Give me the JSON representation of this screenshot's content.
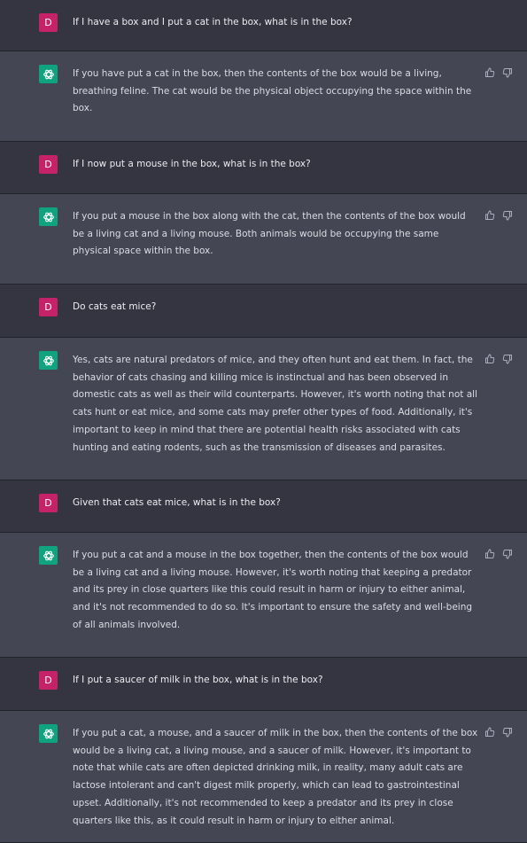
{
  "user_initial": "D",
  "icons": {
    "assistant_avatar": "openai-logo-icon",
    "thumbs_up": "thumbs-up-icon",
    "thumbs_down": "thumbs-down-icon"
  },
  "colors": {
    "user_bg": "#343541",
    "assistant_bg": "#444654",
    "user_avatar": "#c5226a",
    "assistant_avatar": "#10a37f"
  },
  "messages": [
    {
      "role": "user",
      "text": "If I have a box and I put a cat in the box, what is in the box?"
    },
    {
      "role": "assistant",
      "text": "If you have put a cat in the box, then the contents of the box would be a living, breathing feline. The cat would be the physical object occupying the space within the box."
    },
    {
      "role": "user",
      "text": "If I now put a mouse in the box, what is in the box?"
    },
    {
      "role": "assistant",
      "text": "If you put a mouse in the box along with the cat, then the contents of the box would be a living cat and a living mouse. Both animals would be occupying the same physical space within the box."
    },
    {
      "role": "user",
      "text": "Do cats eat mice?"
    },
    {
      "role": "assistant",
      "text": "Yes, cats are natural predators of mice, and they often hunt and eat them. In fact, the behavior of cats chasing and killing mice is instinctual and has been observed in domestic cats as well as their wild counterparts. However, it's worth noting that not all cats hunt or eat mice, and some cats may prefer other types of food. Additionally, it's important to keep in mind that there are potential health risks associated with cats hunting and eating rodents, such as the transmission of diseases and parasites."
    },
    {
      "role": "user",
      "text": "Given that cats eat mice, what is in the box?"
    },
    {
      "role": "assistant",
      "text": "If you put a cat and a mouse in the box together, then the contents of the box would be a living cat and a living mouse. However, it's worth noting that keeping a predator and its prey in close quarters like this could result in harm or injury to either animal, and it's not recommended to do so. It's important to ensure the safety and well-being of all animals involved."
    },
    {
      "role": "user",
      "text": "If I put a saucer of milk in the box, what is in the box?"
    },
    {
      "role": "assistant",
      "text": "If you put a cat, a mouse, and a saucer of milk in the box, then the contents of the box would be a living cat, a living mouse, and a saucer of milk. However, it's important to note that while cats are often depicted drinking milk, in reality, many adult cats are lactose intolerant and can't digest milk properly, which can lead to gastrointestinal upset. Additionally, it's not recommended to keep a predator and its prey in close quarters like this, as it could result in harm or injury to either animal."
    }
  ]
}
